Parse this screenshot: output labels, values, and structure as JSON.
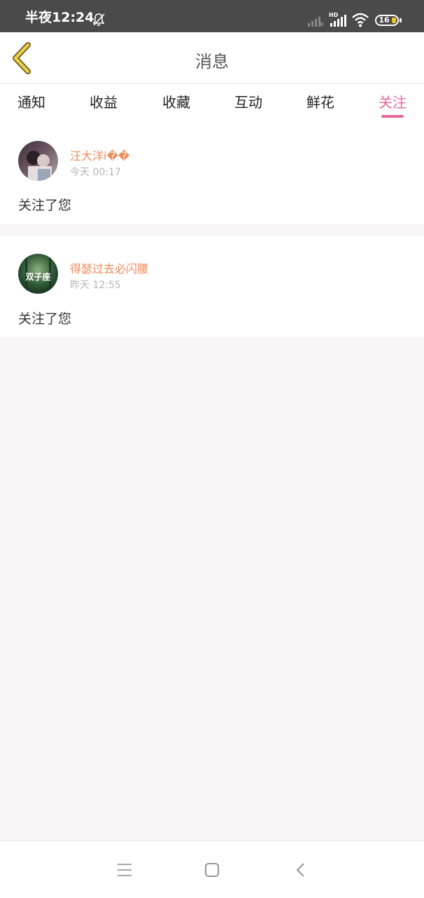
{
  "status_bar": {
    "time": "半夜12:24",
    "battery": "16",
    "hd_label": "HD"
  },
  "header": {
    "title": "消息"
  },
  "tabs": [
    {
      "label": "通知"
    },
    {
      "label": "收益"
    },
    {
      "label": "收藏"
    },
    {
      "label": "互动"
    },
    {
      "label": "鲜花"
    },
    {
      "label": "关注",
      "active": true
    }
  ],
  "messages": [
    {
      "user": "汪大洋i��",
      "time": "今天 00:17",
      "text": "关注了您",
      "avatar_text": ""
    },
    {
      "user": "得瑟过去必闪腰",
      "time": "昨天 12:55",
      "text": "关注了您",
      "avatar_text": "双子座"
    }
  ],
  "colors": {
    "accent": "#e4679f",
    "username": "#f08a5a",
    "back_arrow": "#e2c23a"
  },
  "icons": [
    "bell-off-icon",
    "cellular-signal-icon",
    "wifi-icon",
    "battery-icon",
    "back-arrow-icon",
    "menu-icon",
    "home-square-icon",
    "back-chevron-icon"
  ]
}
